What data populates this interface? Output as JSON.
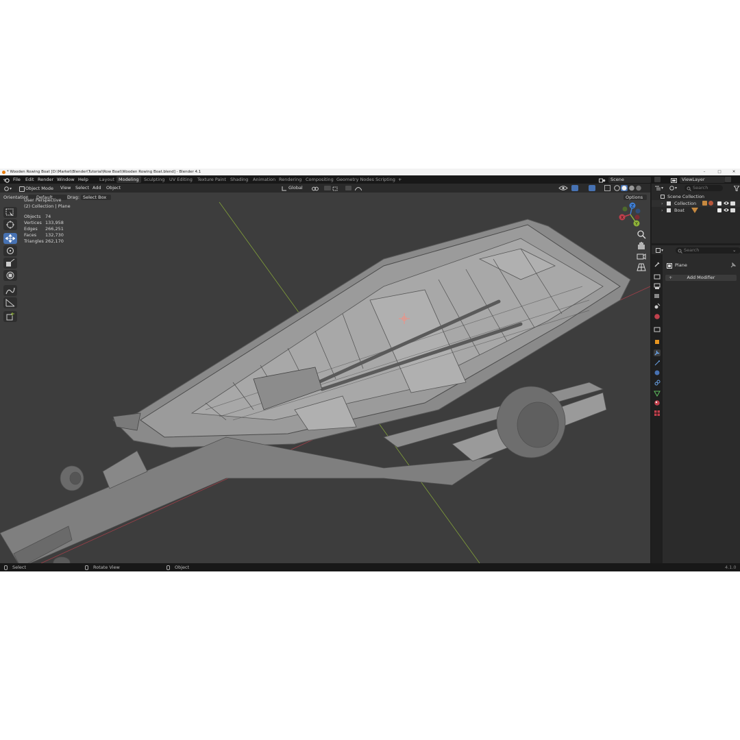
{
  "window": {
    "title": "* Wooden Rowing Boat [D:\\Market\\Blender\\Tutorial\\Row Boat\\Wooden Rowing Boat.blend] - Blender 4.1",
    "controls": [
      "–",
      "□",
      "✕"
    ]
  },
  "menu": [
    "File",
    "Edit",
    "Render",
    "Window",
    "Help"
  ],
  "workspaces": [
    {
      "label": "Layout",
      "active": false
    },
    {
      "label": "Modeling",
      "active": true
    },
    {
      "label": "Sculpting",
      "active": false
    },
    {
      "label": "UV Editing",
      "active": false
    },
    {
      "label": "Texture Paint",
      "active": false
    },
    {
      "label": "Shading",
      "active": false
    },
    {
      "label": "Animation",
      "active": false
    },
    {
      "label": "Rendering",
      "active": false
    },
    {
      "label": "Compositing",
      "active": false
    },
    {
      "label": "Geometry Nodes",
      "active": false
    },
    {
      "label": "Scripting",
      "active": false
    }
  ],
  "add_workspace": "+",
  "scene": {
    "label": "Scene",
    "view_layer": "ViewLayer"
  },
  "viewport_header": {
    "mode": "Object Mode",
    "menus": [
      "View",
      "Select",
      "Add",
      "Object"
    ],
    "transform_orientation": "Global"
  },
  "tool_settings": {
    "orientation_label": "Orientation:",
    "orientation_value": "Default",
    "drag_label": "Drag:",
    "drag_value": "Select Box",
    "options": "Options"
  },
  "overlay": {
    "view_name": "User Perspective",
    "collection_info": "(2) Collection | Plane",
    "stats": [
      {
        "label": "Objects",
        "value": "74"
      },
      {
        "label": "Vertices",
        "value": "133,958"
      },
      {
        "label": "Edges",
        "value": "266,251"
      },
      {
        "label": "Faces",
        "value": "132,730"
      },
      {
        "label": "Triangles",
        "value": "262,170"
      }
    ]
  },
  "gizmo": {
    "x": "X",
    "y": "Y",
    "z": "Z"
  },
  "outliner": {
    "search_placeholder": "Search",
    "root": "Scene Collection",
    "items": [
      "Collection",
      "Boat"
    ]
  },
  "properties": {
    "search_placeholder": "Search",
    "object_name": "Plane",
    "add_modifier": "Add Modifier",
    "active_tab": "modifier"
  },
  "statusbar": {
    "left": "Select",
    "middle": "Rotate View",
    "right": "Object",
    "version": "4.1.0"
  },
  "colors": {
    "accent": "#4772b3",
    "viewport_bg": "#3d3d3d",
    "axis_x": "#c0404c",
    "axis_y": "#8fb339",
    "axis_z": "#3e7fd6"
  }
}
